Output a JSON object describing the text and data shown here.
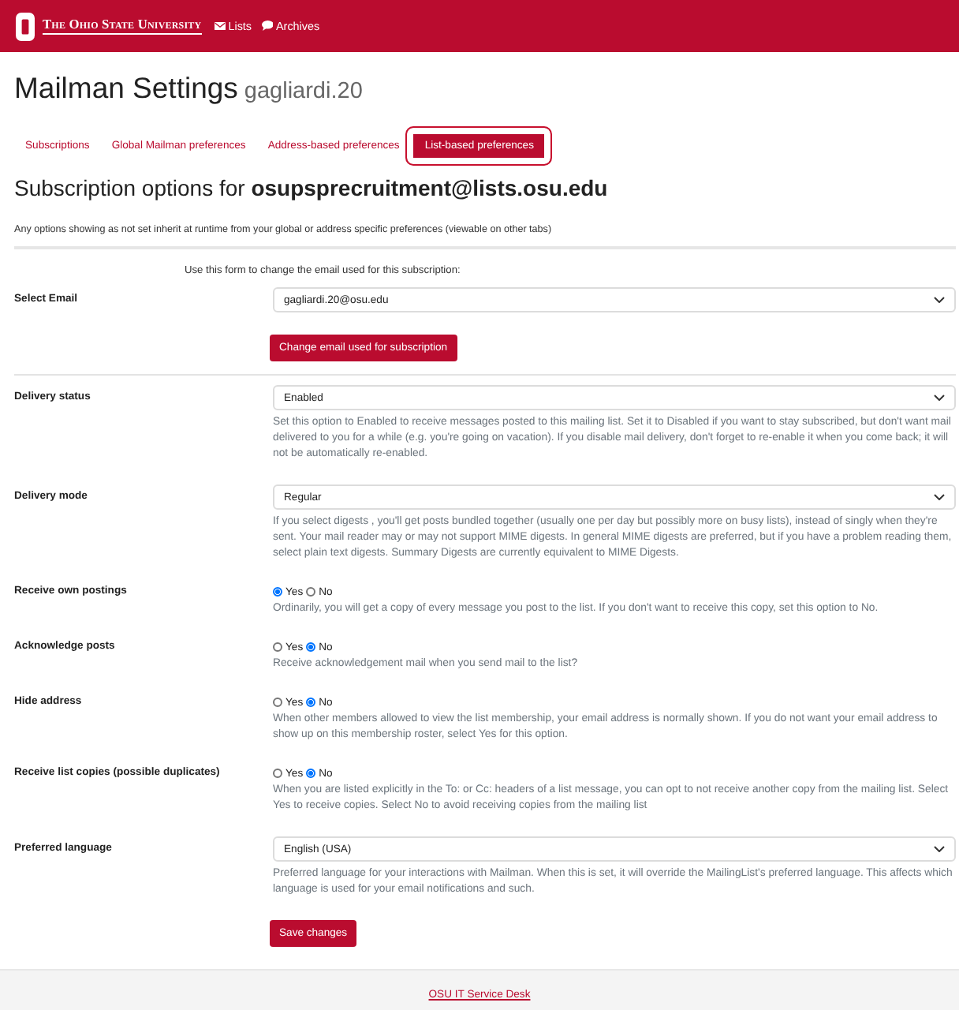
{
  "header": {
    "brand": "The Ohio State University",
    "nav": [
      {
        "label": "Lists"
      },
      {
        "label": "Archives"
      }
    ]
  },
  "page_title": "Mailman Settings",
  "username": "gagliardi.20",
  "tabs": [
    {
      "label": "Subscriptions",
      "selected": false
    },
    {
      "label": "Global Mailman preferences",
      "selected": false
    },
    {
      "label": "Address-based preferences",
      "selected": false
    },
    {
      "label": "List-based preferences",
      "selected": true
    }
  ],
  "heading": "Subscription options for **osupsprecruitment@lists.osu.edu**",
  "note": "Any options showing as not set inherit at runtime from your global or address specific preferences (viewable on other tabs)",
  "email_form": {
    "intro": "Use this form to change the email used for this subscription:",
    "label": "Select Email",
    "value": "gagliardi.20@osu.edu",
    "button": "Change email used for subscription"
  },
  "preferences": [
    {
      "kind": "select",
      "label": "Delivery status",
      "value": "Enabled",
      "help": "Set this option to Enabled to receive messages posted to this mailing list. Set it to Disabled if you want to stay subscribed, but don't want mail delivered to you for a while (e.g. you're going on vacation). If you disable mail delivery, don't forget to re-enable it when you come back; it will not be automatically re-enabled."
    },
    {
      "kind": "select",
      "label": "Delivery mode",
      "value": "Regular",
      "help": "If you select digests , you'll get posts bundled together (usually one per day but possibly more on busy lists), instead of singly when they're sent. Your mail reader may or may not support MIME digests. In general MIME digests are preferred, but if you have a problem reading them, select plain text digests. Summary Digests are currently equivalent to MIME Digests."
    },
    {
      "kind": "radio",
      "label": "Receive own postings",
      "options": [
        {
          "label": "Yes",
          "selected": true
        },
        {
          "label": "No",
          "selected": false
        }
      ],
      "help": "Ordinarily, you will get a copy of every message you post to the list. If you don't want to receive this copy, set this option to No."
    },
    {
      "kind": "radio",
      "label": "Acknowledge posts",
      "options": [
        {
          "label": "Yes",
          "selected": false
        },
        {
          "label": "No",
          "selected": true
        }
      ],
      "help": "Receive acknowledgement mail when you send mail to the list?"
    },
    {
      "kind": "radio",
      "label": "Hide address",
      "options": [
        {
          "label": "Yes",
          "selected": false
        },
        {
          "label": "No",
          "selected": true
        }
      ],
      "help": "When other members allowed to view the list membership, your email address is normally shown. If you do not want your email address to show up on this membership roster, select Yes for this option."
    },
    {
      "kind": "radio",
      "label": "Receive list copies (possible duplicates)",
      "options": [
        {
          "label": "Yes",
          "selected": false
        },
        {
          "label": "No",
          "selected": true
        }
      ],
      "help": "When you are listed explicitly in the To: or Cc: headers of a list message, you can opt to not receive another copy from the mailing list. Select Yes to receive copies. Select No to avoid receiving copies from the mailing list"
    },
    {
      "kind": "select",
      "label": "Preferred language",
      "value": "English (USA)",
      "help": "Preferred language for your interactions with Mailman. When this is set, it will override the MailingList's preferred language. This affects which language is used for your email notifications and such."
    }
  ],
  "save_button": "Save changes",
  "footer": {
    "link": "OSU IT Service Desk"
  }
}
